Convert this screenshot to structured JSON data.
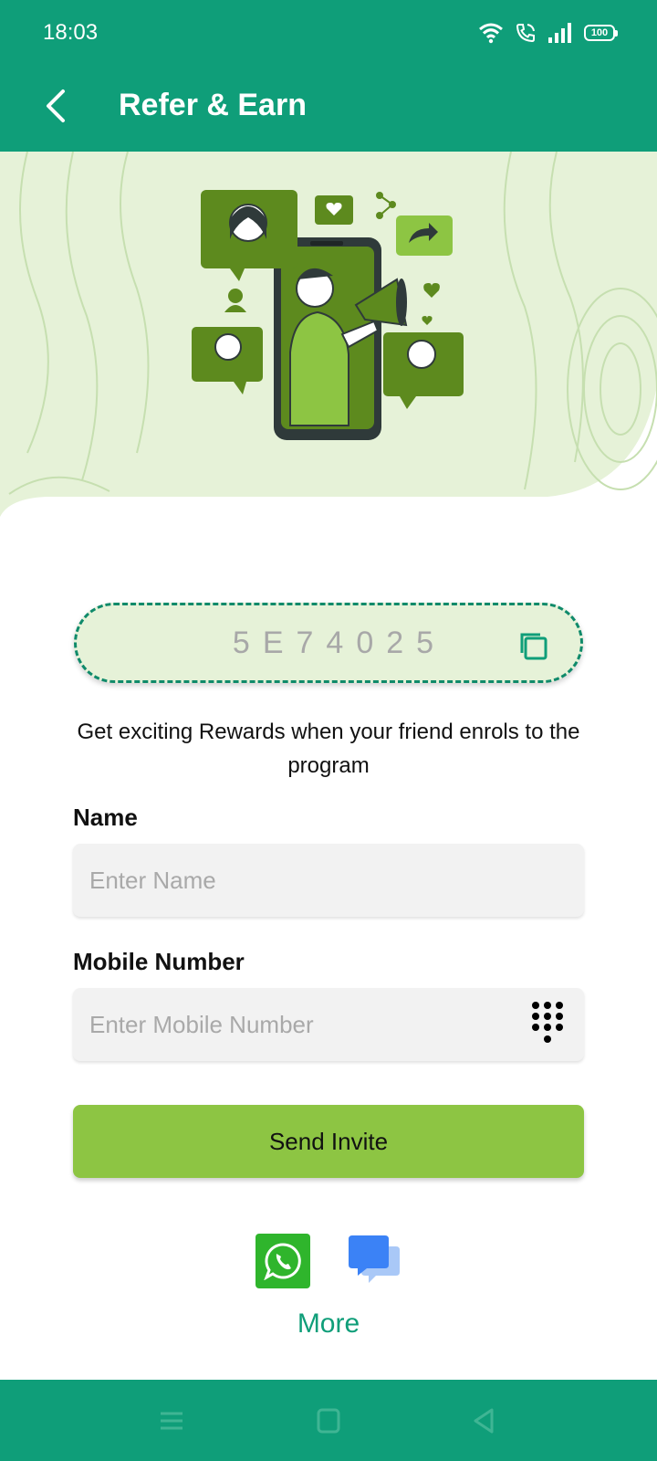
{
  "status_bar": {
    "time": "18:03",
    "battery": "100"
  },
  "app_bar": {
    "title": "Refer & Earn"
  },
  "referral": {
    "code": "5E74025"
  },
  "description": "Get exciting Rewards when your friend enrols to the program",
  "form": {
    "name_label": "Name",
    "name_placeholder": "Enter Name",
    "mobile_label": "Mobile Number",
    "mobile_placeholder": "Enter Mobile Number",
    "send_label": "Send Invite"
  },
  "share": {
    "more_label": "More"
  },
  "colors": {
    "primary": "#0f9e79",
    "accent_green": "#8dc543",
    "code_bg": "#e6f2d8",
    "whatsapp": "#2fb52c",
    "message": "#3b82f6"
  },
  "icons": [
    "back-arrow-icon",
    "wifi-icon",
    "call-icon",
    "signal-icon",
    "battery-icon",
    "copy-icon",
    "dialpad-icon",
    "whatsapp-icon",
    "message-icon",
    "menu-icon",
    "home-icon",
    "back-nav-icon"
  ]
}
